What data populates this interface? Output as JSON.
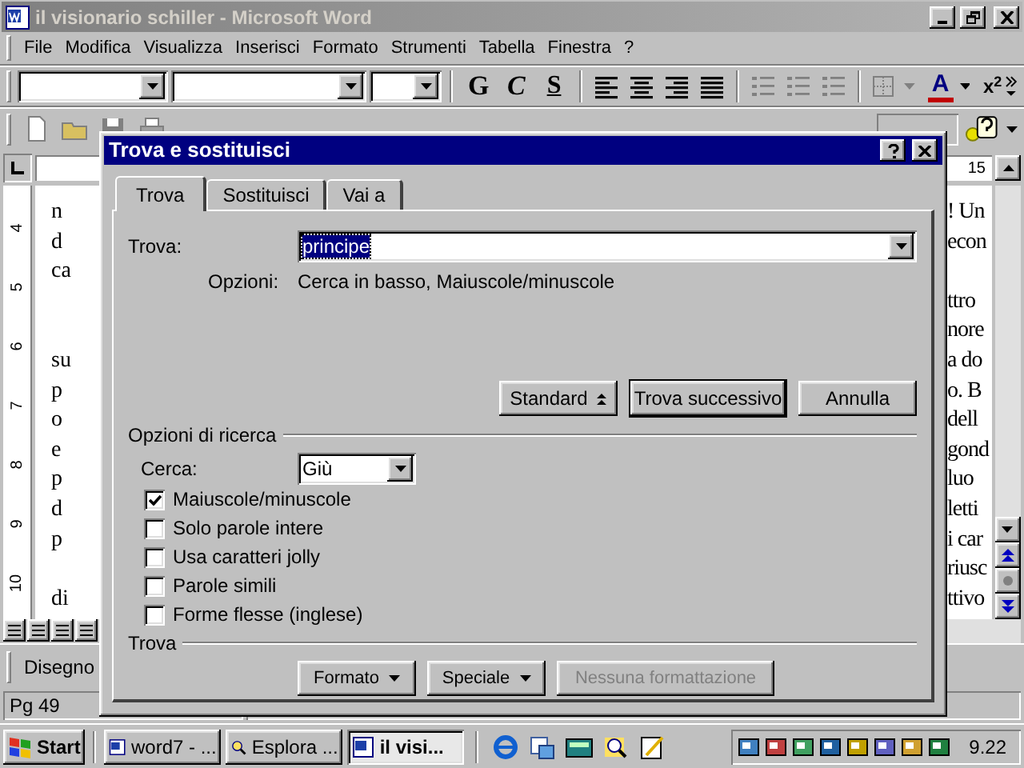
{
  "window": {
    "title": "il visionario schiller - Microsoft Word"
  },
  "menu": [
    "File",
    "Modifica",
    "Visualizza",
    "Inserisci",
    "Formato",
    "Strumenti",
    "Tabella",
    "Finestra",
    "?"
  ],
  "format_toolbar": {
    "style_buttons": [
      {
        "label": "G",
        "kind": "bold"
      },
      {
        "label": "C",
        "kind": "italic"
      },
      {
        "label": "S",
        "kind": "underline"
      }
    ],
    "font_color": "A",
    "superscript": "x$^{2}$"
  },
  "ruler": {
    "mark": "15",
    "vertical": [
      "4",
      "5",
      "6",
      "7",
      "8",
      "9",
      "10"
    ]
  },
  "document": {
    "rows": [
      {
        "left": "n",
        "right": "! Un"
      },
      {
        "left": "d",
        "right": "econ"
      },
      {
        "left": "ca",
        "right": ""
      },
      {
        "left": "",
        "right": "ttro"
      },
      {
        "left": "",
        "right": "nore"
      },
      {
        "left": "su",
        "right": "a do"
      },
      {
        "left": "p",
        "right": "o. B"
      },
      {
        "left": "o",
        "right": "dell"
      },
      {
        "left": "e",
        "right": "gond"
      },
      {
        "left": "p",
        "right": "luo"
      },
      {
        "left": "d",
        "right": "letti"
      },
      {
        "left": "p",
        "right": "i car"
      },
      {
        "left": "",
        "right": "riusc"
      },
      {
        "left": "di",
        "right": "ttivo"
      }
    ]
  },
  "drawing_toolbar": {
    "label": "Disegno"
  },
  "status_bar": {
    "page": "Pg 49"
  },
  "dialog": {
    "title": "Trova e sostituisci",
    "tabs": [
      {
        "label": "Trova",
        "selected": true
      },
      {
        "label": "Sostituisci",
        "selected": false
      },
      {
        "label": "Vai a",
        "selected": false
      }
    ],
    "find": {
      "label": "Trova:",
      "value": "principe"
    },
    "options": {
      "label": "Opzioni:",
      "value": "Cerca in basso, Maiuscole/minuscole"
    },
    "buttons": [
      {
        "label": "Standard",
        "kind": "toggle"
      },
      {
        "label": "Trova successivo",
        "kind": "default"
      },
      {
        "label": "Annulla",
        "kind": "normal"
      }
    ],
    "search_options": {
      "title": "Opzioni di ricerca",
      "direction": {
        "label": "Cerca:",
        "value": "Giù"
      },
      "checkboxes": [
        {
          "label": "Maiuscole/minuscole",
          "checked": true
        },
        {
          "label": "Solo parole intere",
          "checked": false
        },
        {
          "label": "Usa caratteri jolly",
          "checked": false
        },
        {
          "label": "Parole simili",
          "checked": false
        },
        {
          "label": "Forme flesse (inglese)",
          "checked": false
        }
      ]
    },
    "format_section": {
      "title": "Trova",
      "buttons": [
        {
          "label": "Formato",
          "disabled": false
        },
        {
          "label": "Speciale",
          "disabled": false
        },
        {
          "label": "Nessuna formattazione",
          "disabled": true
        }
      ]
    }
  },
  "taskbar": {
    "start": "Start",
    "tasks": [
      {
        "label": "word7 - ...",
        "selected": false
      },
      {
        "label": "Esplora ...",
        "selected": false
      },
      {
        "label": "il visi...",
        "selected": true
      }
    ],
    "clock": "9.22"
  }
}
